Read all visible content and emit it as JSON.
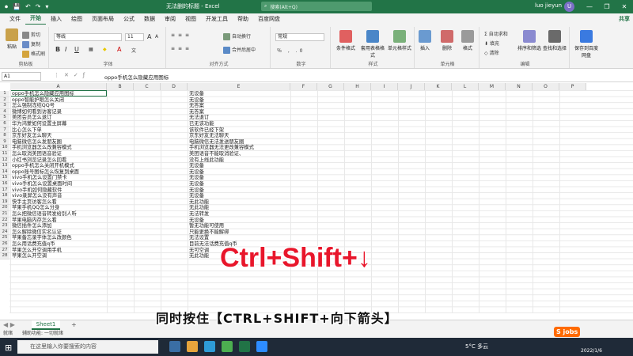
{
  "titlebar": {
    "title": "无法删的标题 - Excel",
    "search_placeholder": "搜索(Alt+Q)",
    "user_name": "luo jieyun",
    "avatar_letter": "U"
  },
  "tabs": [
    "文件",
    "开始",
    "插入",
    "绘图",
    "页面布局",
    "公式",
    "数据",
    "审阅",
    "视图",
    "开发工具",
    "帮助",
    "百度网盘"
  ],
  "active_tab": "开始",
  "share_label": "共享",
  "ribbon": {
    "clipboard": {
      "paste": "粘贴",
      "cut": "剪切",
      "copy": "复制",
      "format_painter": "格式刷",
      "label": "剪贴板"
    },
    "font": {
      "font_name": "等线",
      "font_size": "11",
      "label": "字体",
      "bold": "B",
      "italic": "I",
      "underline": "U",
      "grow": "A",
      "shrink": "A"
    },
    "alignment": {
      "wrap": "自动换行",
      "merge": "合并后居中",
      "label": "对齐方式"
    },
    "number": {
      "format": "常规",
      "label": "数字"
    },
    "styles": {
      "conditional": "条件格式",
      "table": "套用表格格式",
      "cell_styles": "单元格样式",
      "label": "样式"
    },
    "cells": {
      "insert": "插入",
      "delete": "删除",
      "format": "格式",
      "label": "单元格"
    },
    "editing": {
      "autosum": "自动求和",
      "fill": "填充",
      "clear": "清除",
      "sort": "排序和筛选",
      "find": "查找和选择",
      "label": "编辑"
    },
    "save": {
      "label": "保存到百度网盘",
      "button": "保存到百度网盘"
    }
  },
  "formula": {
    "namebox": "A1",
    "content": "oppo手机怎么隐藏应用图标"
  },
  "columns": [
    "A",
    "B",
    "C",
    "D",
    "E",
    "F",
    "G",
    "H",
    "I",
    "J",
    "K",
    "L",
    "M",
    "N",
    "O",
    "P"
  ],
  "rows": [
    {
      "n": "1",
      "a": "oppo手机怎么隐藏应用图标",
      "e": "无设备"
    },
    {
      "n": "2",
      "a": "oppo智能护眼怎么关闭",
      "e": "无设备"
    },
    {
      "n": "3",
      "a": "怎么强制冻结QQ号",
      "e": "无答案"
    },
    {
      "n": "4",
      "a": "微博如何看到访客记录",
      "e": "无答案"
    },
    {
      "n": "5",
      "a": "美团会员怎么退订",
      "e": "无法退订"
    },
    {
      "n": "6",
      "a": "华为鸿蒙如何设置主屏幕",
      "e": "已无该功能"
    },
    {
      "n": "7",
      "a": "比心怎么下单",
      "e": "该软件已经下架"
    },
    {
      "n": "8",
      "a": "京东好友怎么聊天",
      "e": "京东好友无法聊天"
    },
    {
      "n": "9",
      "a": "电脑微信怎么发朋友圈",
      "e": "电脑微信无法发送朋友圈"
    },
    {
      "n": "10",
      "a": "手机浏览器怎么改兼容模式",
      "e": "手机浏览器无法更改兼容模式"
    },
    {
      "n": "11",
      "a": "怎么取消美团语音验证",
      "e": "美团语音不能取消验证、"
    },
    {
      "n": "12",
      "a": "小红书浏览记录怎么回看",
      "e": "没有上线此功能"
    },
    {
      "n": "13",
      "a": "oppo手机怎么关闭开机模式",
      "e": "无设备"
    },
    {
      "n": "14",
      "a": "oppo账号图标怎么恢复到桌面",
      "e": "无设备"
    },
    {
      "n": "15",
      "a": "vivo手机怎么设置门禁卡",
      "e": "无设备"
    },
    {
      "n": "16",
      "a": "vivo手机怎么设置桌面时间",
      "e": "无设备"
    },
    {
      "n": "17",
      "a": "vivo手机如何隐藏软件",
      "e": "无设备"
    },
    {
      "n": "18",
      "a": "vivo录屏怎么没有声音",
      "e": "无设备"
    },
    {
      "n": "19",
      "a": "快手主页访客怎么看",
      "e": "无此功能"
    },
    {
      "n": "20",
      "a": "苹果手机QQ怎么分身",
      "e": "无此功能"
    },
    {
      "n": "21",
      "a": "怎么把微信语音转发给别人听",
      "e": "无法转发"
    },
    {
      "n": "22",
      "a": "苹果电脑内存怎么看",
      "e": "无设备"
    },
    {
      "n": "23",
      "a": "微信插件怎么添加",
      "e": "暂无功能可使用"
    },
    {
      "n": "24",
      "a": "怎么解除微信实名认证",
      "e": "只能更换不能解绑"
    },
    {
      "n": "25",
      "a": "苹果备忘录字体怎么改颜色",
      "e": "无法设置"
    },
    {
      "n": "26",
      "a": "怎么用话费充值q币",
      "e": "目前无法话费充值q币"
    },
    {
      "n": "27",
      "a": "苹果怎么开空调用手机",
      "e": "无可空调"
    },
    {
      "n": "28",
      "a": "苹果怎么开空调",
      "e": "无此功能"
    }
  ],
  "sheet": {
    "name": "Sheet1",
    "add": "+"
  },
  "status": {
    "ready": "就绪",
    "accessibility": "辅助功能: 一切就绪"
  },
  "taskbar": {
    "search_placeholder": "在这里输入你要搜索的内容",
    "temperature": "5°C 多云",
    "date": "2022/1/6"
  },
  "overlay": {
    "shortcut": "Ctrl+Shift+↓",
    "caption": "同时按住【CTRL+SHIFT+向下箭头】"
  },
  "watermark": {
    "text": "S jobs"
  },
  "colors": {
    "excel_green": "#217346",
    "overlay_red": "#e8162b"
  }
}
